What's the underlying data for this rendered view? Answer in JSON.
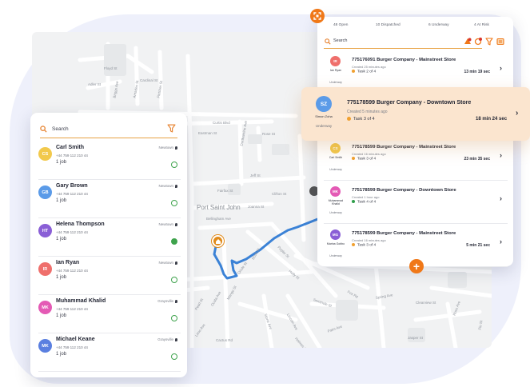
{
  "colors": {
    "accent": "#f07818",
    "search_underline": "#e8a244",
    "status_green": "#3fa34d",
    "route_blue": "#3b82d6",
    "highlight_bg": "#fbe5cf",
    "task_orange": "#f0a030",
    "task_green": "#2f9e4a"
  },
  "map": {
    "labels": [
      "Floyd St",
      "Cardinal St",
      "Adler St",
      "Briggs Ave",
      "Amadeo St",
      "Fletcher St",
      "Curtis Blvd",
      "Eastman St",
      "Dorthamine Ave",
      "Rose St",
      "Jeff St",
      "Fairfax St",
      "Clifton St",
      "Port Saint John",
      "Joanna St",
      "Bellingham Ave",
      "Scott St",
      "Oriole St",
      "Poplar St",
      "Holly St",
      "Pearl St",
      "Ocala Ave",
      "Mango St",
      "Stone Ave",
      "Lincoln Ave",
      "Seminole St",
      "Spring Ave",
      "Clearview St",
      "Ross Ave",
      "Jasper St",
      "Palm Ave",
      "Lime Ave",
      "Cactus Rd",
      "Holmes St",
      "Fox Rd",
      "Flo St"
    ]
  },
  "drivers_panel": {
    "search_placeholder": "Search",
    "icons": {
      "search": "search-icon",
      "filter": "filter-icon",
      "location": "location-pin-icon"
    },
    "drivers": [
      {
        "initials": "CS",
        "name": "Carl Smith",
        "phone": "+44 759 112 210 44",
        "jobs": "1 job",
        "location": "Newtown",
        "color": "#f2c94c",
        "online": false
      },
      {
        "initials": "GB",
        "name": "Gary Brown",
        "phone": "+44 759 112 210 44",
        "jobs": "1 job",
        "location": "Newtown",
        "color": "#5b9be8",
        "online": false
      },
      {
        "initials": "HT",
        "name": "Helena Thompson",
        "phone": "+44 759 112 210 44",
        "jobs": "1 job",
        "location": "Newtown",
        "color": "#8a5fd6",
        "online": true
      },
      {
        "initials": "IR",
        "name": "Ian Ryan",
        "phone": "+44 759 112 210 44",
        "jobs": "1 job",
        "location": "Newtown",
        "color": "#ef6f6c",
        "online": false
      },
      {
        "initials": "MK",
        "name": "Muhammad Khalid",
        "phone": "+44 759 112 210 44",
        "jobs": "1 job",
        "location": "Graysville",
        "color": "#e45ab5",
        "online": false
      },
      {
        "initials": "MK",
        "name": "Michael Keane",
        "phone": "+44 759 112 210 44",
        "jobs": "1 job",
        "location": "Graysville",
        "color": "#5a7fe0",
        "online": false
      }
    ]
  },
  "orders_panel": {
    "tabs": [
      "48 Open",
      "10 Dispatched",
      "6 Underway",
      "4 At Risk"
    ],
    "search_placeholder": "Search",
    "icons": {
      "search": "search-icon",
      "alert": "alert-icon",
      "refresh": "refresh-icon",
      "filter": "filter-icon",
      "list": "list-icon",
      "expand": "expand-icon",
      "add": "add-icon"
    },
    "add_label": "+",
    "orders": [
      {
        "initials": "IR",
        "driver": "Ian Ryan",
        "status": "Underway",
        "title": "775176091 Burger Company - Mainstreet Store",
        "created": "Created 25 minutes ago",
        "task": "Task 2 of 4",
        "time": "13 min 19 sec",
        "avatar_color": "#ef6f6c",
        "task_color": "#f0a030"
      },
      {
        "initials": "CS",
        "driver": "Carl Smith",
        "status": "Underway",
        "title": "775178599 Burger Company - Mainstreet Store",
        "created": "Created 16 minutes ago",
        "task": "Task 3 of 4",
        "time": "23 min 35 sec",
        "avatar_color": "#f2c94c",
        "task_color": "#f0a030"
      },
      {
        "initials": "MK",
        "driver": "Muhammad Khalid",
        "status": "Underway",
        "title": "775178599 Burger Company - Downtown Store",
        "created": "Created 1 hour ago",
        "task": "Task 4 of 4",
        "time": "",
        "avatar_color": "#e45ab5",
        "task_color": "#2f9e4a"
      },
      {
        "initials": "MG",
        "driver": "Marina Gobbo",
        "status": "Underway",
        "title": "775178599 Burger Company - Mainstreet Store",
        "created": "Created 16 minutes ago",
        "task": "Task 3 of 4",
        "time": "5 min 21 sec",
        "avatar_color": "#8a5fd6",
        "task_color": "#f0a030"
      }
    ]
  },
  "highlighted_order": {
    "initials": "SZ",
    "driver": "Simon Zoha",
    "status": "Underway",
    "title": "775178599 Burger Company - Downtown Store",
    "created": "Created 5 minutes ago",
    "task": "Task 3 of 4",
    "time": "18 min 24 sec",
    "avatar_color": "#5b9be8",
    "task_color": "#f0a030"
  }
}
